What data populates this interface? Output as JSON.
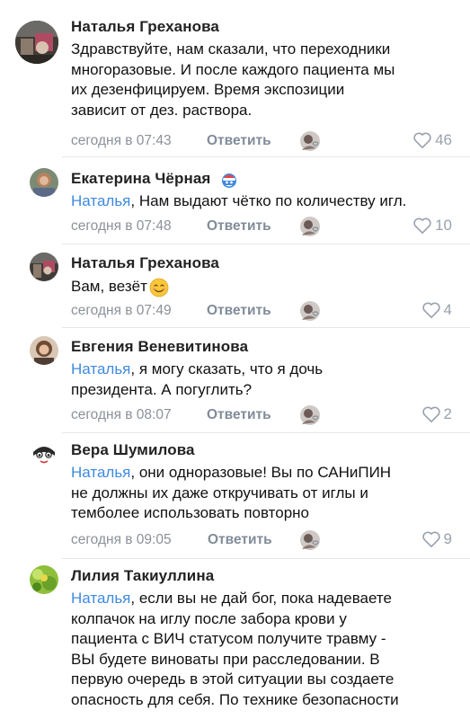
{
  "comments": [
    {
      "author": "Наталья Греханова",
      "mention": "",
      "lines": [
        "Здравствуйте, нам сказали, что переходники",
        "многоразовые. И после каждого пациента мы",
        "их дезенфицируем. Время  экспозиции",
        "зависит от дез. раствора."
      ],
      "time": "сегодня в 07:43",
      "reply": "Ответить",
      "likes": "46"
    },
    {
      "author": "Екатерина Чёрная",
      "mention": "Наталья",
      "lines": [
        ", Нам выдают чётко по количеству игл."
      ],
      "time": "сегодня в 07:48",
      "reply": "Ответить",
      "likes": "10"
    },
    {
      "author": "Наталья Греханова",
      "mention": "",
      "lines": [
        "Вам, везёт"
      ],
      "time": "сегодня в 07:49",
      "reply": "Ответить",
      "likes": "4"
    },
    {
      "author": "Евгения Веневитинова",
      "mention": "Наталья",
      "lines": [
        ", я могу сказать, что я дочь",
        "президента. А погуглить?"
      ],
      "time": "сегодня в 08:07",
      "reply": "Ответить",
      "likes": "2"
    },
    {
      "author": "Вера Шумилова",
      "mention": "Наталья",
      "lines": [
        ", они одноразовые! Вы по САНиПИН",
        "не должны их даже откручивать от иглы и",
        "темболее использовать повторно"
      ],
      "time": "сегодня в 09:05",
      "reply": "Ответить",
      "likes": "9"
    },
    {
      "author": "Лилия Такиуллина",
      "mention": "Наталья",
      "lines": [
        ", если вы не дай бог, пока надеваете",
        "колпачок на иглу после забора крови у",
        "пациента с ВИЧ статусом получите травму -",
        "ВЫ будете виноваты при расследовании. В",
        "первую очередь в этой ситуации вы  создаете",
        "опасность для себя. По технике безопасности"
      ]
    }
  ],
  "icons": {
    "like": "heart-outline-icon",
    "liked_by": "liker-avatar-icon",
    "badge": "santa-badge-icon",
    "emoji": "smiling-face-emoji"
  },
  "colors": {
    "mention": "#3f8ae0",
    "meta": "#8b9199",
    "like": "#99a2ad"
  }
}
